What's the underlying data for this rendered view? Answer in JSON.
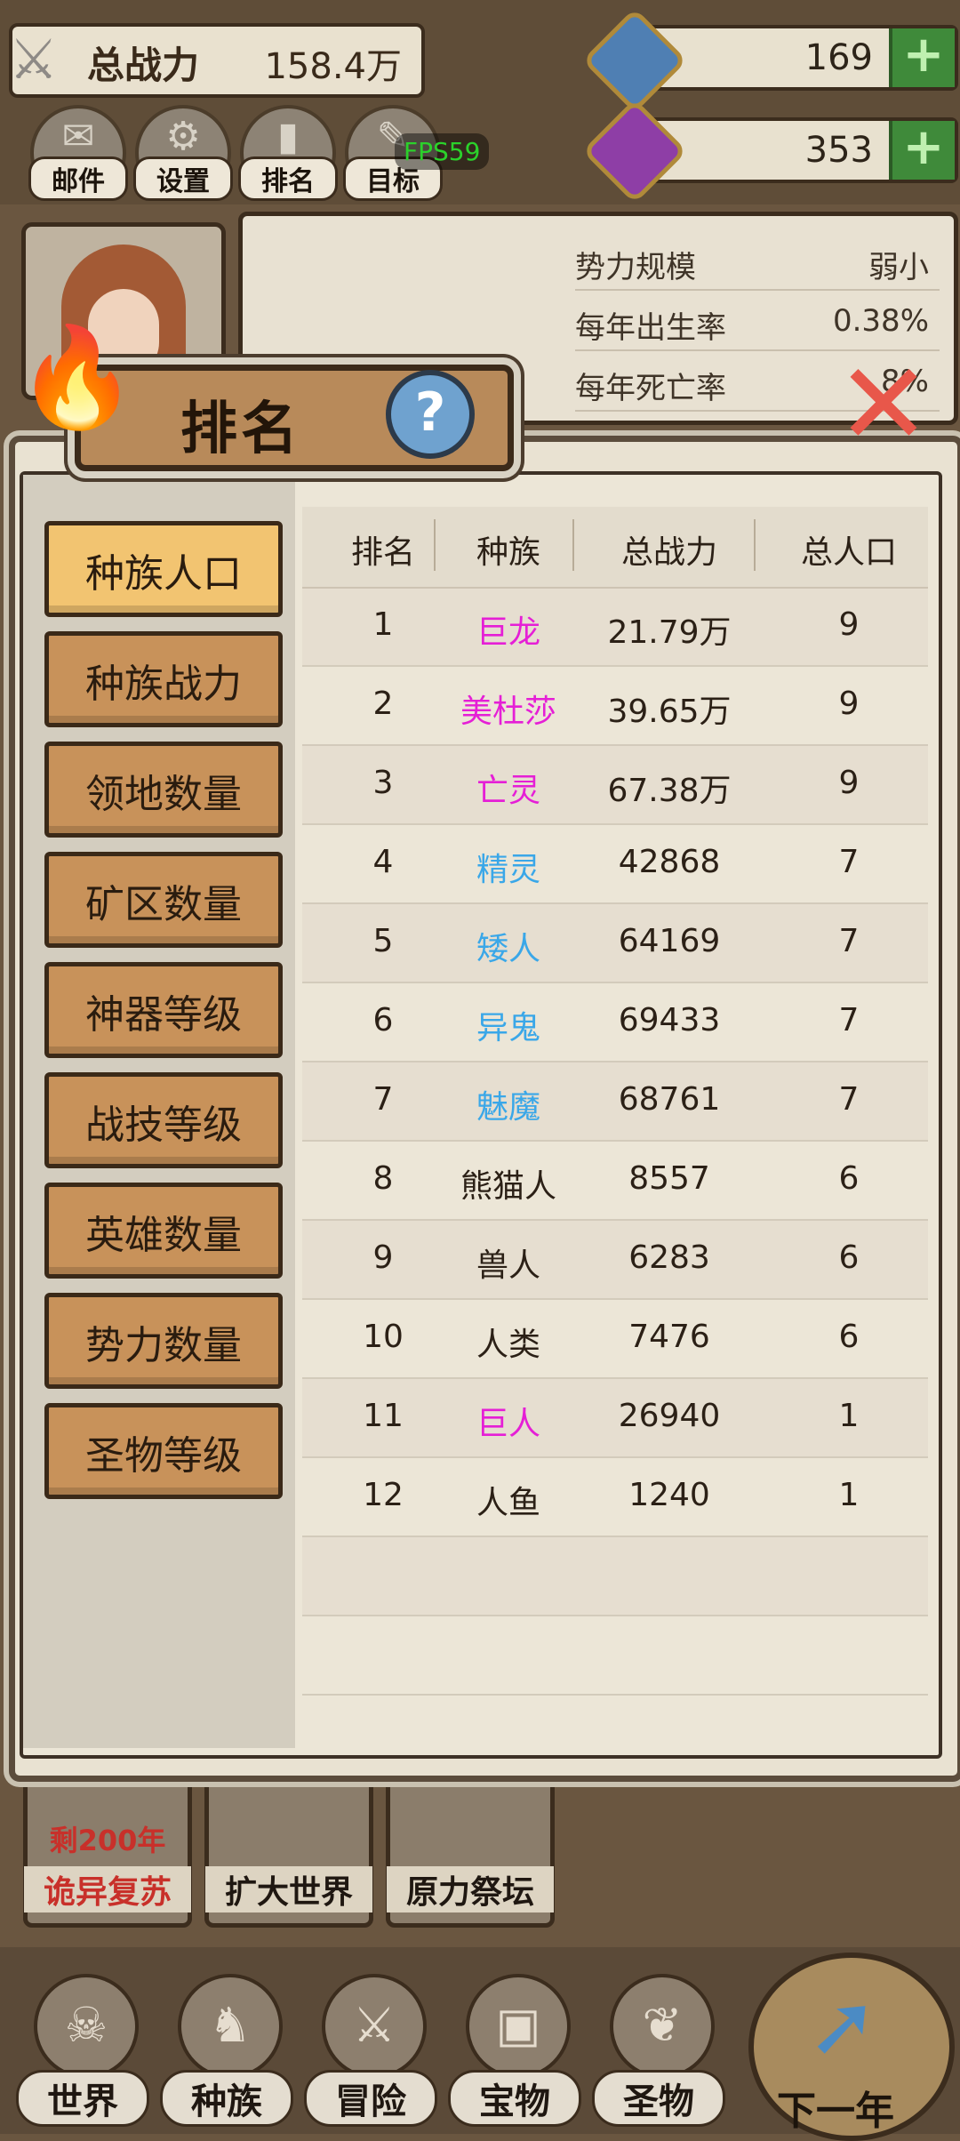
{
  "hud": {
    "power_label": "总战力",
    "power_value": "158.4万",
    "resource1_value": "169",
    "resource2_value": "353",
    "plus_symbol": "+",
    "fps": "FPS59",
    "menu": [
      {
        "label": "邮件",
        "icon": "mail-icon"
      },
      {
        "label": "设置",
        "icon": "gear-icon"
      },
      {
        "label": "排名",
        "icon": "ranking-icon"
      },
      {
        "label": "目标",
        "icon": "goal-icon"
      }
    ]
  },
  "info_panel": {
    "rows": [
      {
        "k": "势力规模",
        "v": "弱小"
      },
      {
        "k": "每年出生率",
        "v": "0.38%"
      },
      {
        "k": "每年死亡率",
        "v": "8%"
      }
    ]
  },
  "modal": {
    "title": "排名",
    "help": "?",
    "categories": [
      "种族人口",
      "种族战力",
      "领地数量",
      "矿区数量",
      "神器等级",
      "战技等级",
      "英雄数量",
      "势力数量",
      "圣物等级"
    ],
    "active_index": 0,
    "headers": [
      "排名",
      "种族",
      "总战力",
      "总人口"
    ],
    "rows": [
      {
        "rank": "1",
        "race": "巨龙",
        "power": "21.79万",
        "pop": "9",
        "color": "#e51fd6"
      },
      {
        "rank": "2",
        "race": "美杜莎",
        "power": "39.65万",
        "pop": "9",
        "color": "#e51fd6"
      },
      {
        "rank": "3",
        "race": "亡灵",
        "power": "67.38万",
        "pop": "9",
        "color": "#e51fd6"
      },
      {
        "rank": "4",
        "race": "精灵",
        "power": "42868",
        "pop": "7",
        "color": "#3aa7e8"
      },
      {
        "rank": "5",
        "race": "矮人",
        "power": "64169",
        "pop": "7",
        "color": "#3aa7e8"
      },
      {
        "rank": "6",
        "race": "异鬼",
        "power": "69433",
        "pop": "7",
        "color": "#3aa7e8"
      },
      {
        "rank": "7",
        "race": "魅魔",
        "power": "68761",
        "pop": "7",
        "color": "#3aa7e8"
      },
      {
        "rank": "8",
        "race": "熊猫人",
        "power": "8557",
        "pop": "6",
        "color": "#2b2016"
      },
      {
        "rank": "9",
        "race": "兽人",
        "power": "6283",
        "pop": "6",
        "color": "#2b2016"
      },
      {
        "rank": "10",
        "race": "人类",
        "power": "7476",
        "pop": "6",
        "color": "#2b2016"
      },
      {
        "rank": "11",
        "race": "巨人",
        "power": "26940",
        "pop": "1",
        "color": "#e51fd6"
      },
      {
        "rank": "12",
        "race": "人鱼",
        "power": "1240",
        "pop": "1",
        "color": "#2b2016"
      }
    ]
  },
  "underlay": {
    "buttons": [
      {
        "label": "诡异复苏",
        "sub": "剩200年"
      },
      {
        "label": "扩大世界",
        "sub": ""
      },
      {
        "label": "原力祭坛",
        "sub": ""
      }
    ]
  },
  "nav": {
    "items": [
      {
        "label": "世界",
        "icon": "world-icon"
      },
      {
        "label": "种族",
        "icon": "race-icon"
      },
      {
        "label": "冒险",
        "icon": "adventure-icon"
      },
      {
        "label": "宝物",
        "icon": "treasure-icon"
      },
      {
        "label": "圣物",
        "icon": "relic-icon"
      }
    ],
    "next_year": "下一年"
  }
}
